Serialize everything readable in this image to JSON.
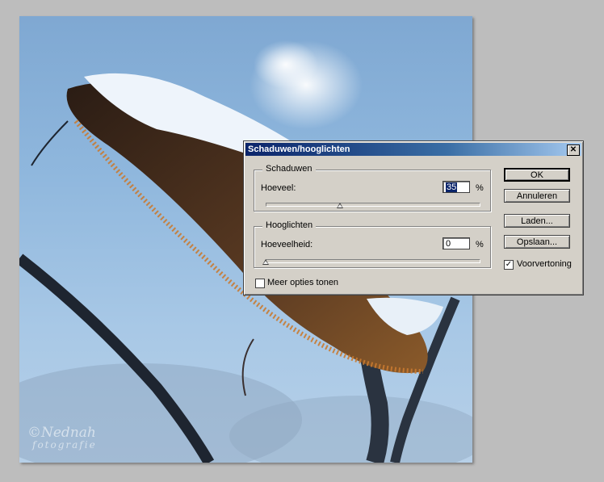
{
  "photo": {
    "watermark_line1": "©Nednah",
    "watermark_line2": "fotografie"
  },
  "dialog": {
    "title": "Schaduwen/hooglichten",
    "close_glyph": "✕",
    "shadows": {
      "legend": "Schaduwen",
      "amount_label": "Hoeveel:",
      "amount_value": "35",
      "unit": "%",
      "slider_fraction": 0.35
    },
    "highlights": {
      "legend": "Hooglichten",
      "amount_label": "Hoeveelheid:",
      "amount_value": "0",
      "unit": "%",
      "slider_fraction": 0.0
    },
    "more_options_label": "Meer opties tonen",
    "more_options_checked": false,
    "buttons": {
      "ok": "OK",
      "cancel": "Annuleren",
      "load": "Laden...",
      "save": "Opslaan..."
    },
    "preview_label": "Voorvertoning",
    "preview_checked": true,
    "check_glyph": "✓"
  },
  "colors": {
    "title_start": "#0a246a",
    "dialog_bg": "#d4d0c8",
    "canvas_bg": "#bdbdbd"
  }
}
